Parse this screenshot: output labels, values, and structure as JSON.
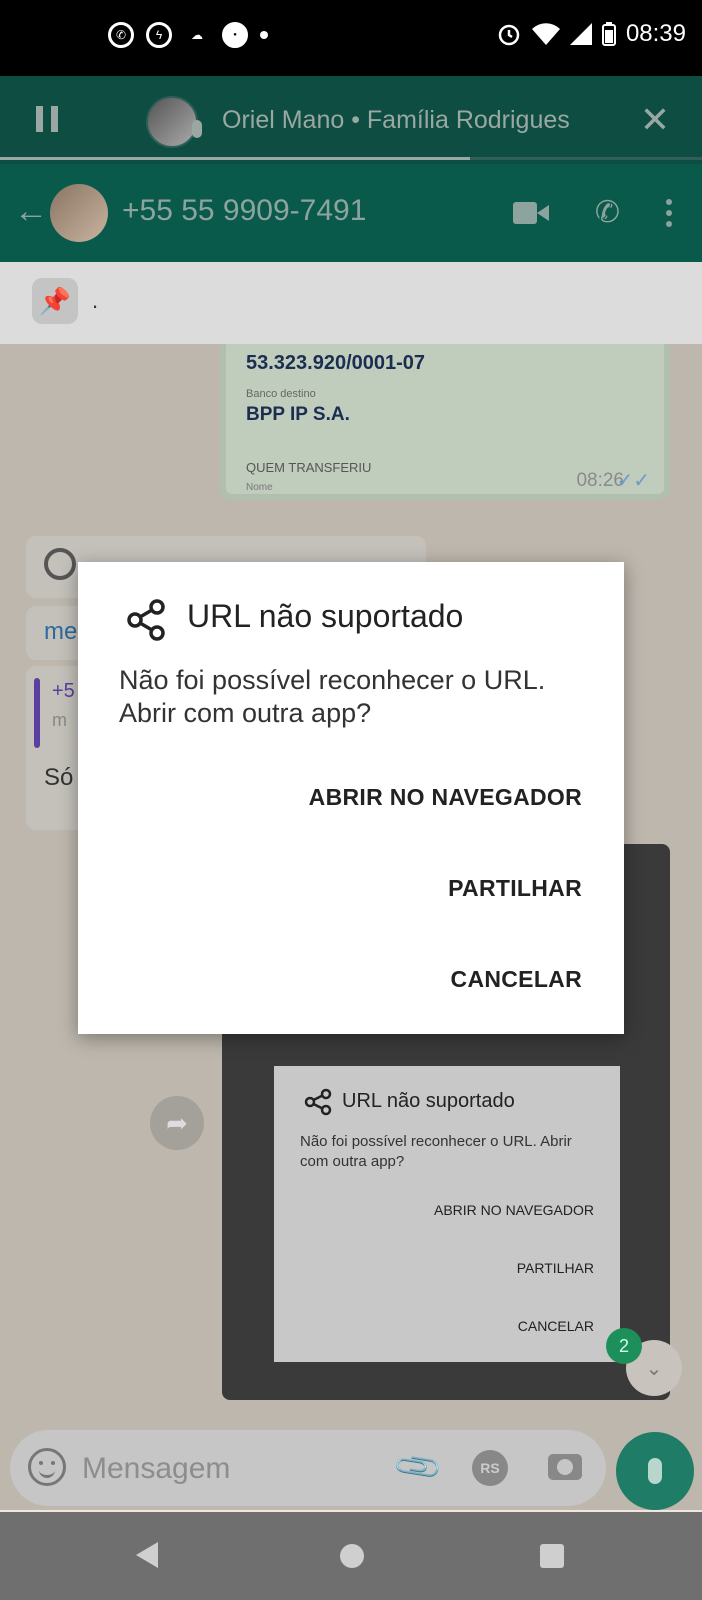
{
  "status_bar": {
    "time": "08:39"
  },
  "voice_bar": {
    "title": "Oriel Mano • Família Rodrigues",
    "progress": 0.67
  },
  "chat_header": {
    "title": "+55 55 9909-7491"
  },
  "pinned": {
    "text": "."
  },
  "receipt": {
    "cnpj": "53.323.920/0001-07",
    "bank_label": "Banco destino",
    "bank": "BPP IP S.A.",
    "section": "QUEM TRANSFERIU",
    "name_label": "Nome",
    "time": "08:26"
  },
  "bubbles": {
    "link_fragment": "me",
    "quote_title": "+5",
    "quote_preview": "m",
    "message": "Só"
  },
  "mini_dialog": {
    "title": "URL não suportado",
    "message": "Não foi possível reconhecer o URL. Abrir com outra app?",
    "open_browser": "ABRIR NO NAVEGADOR",
    "share": "PARTILHAR",
    "cancel": "CANCELAR",
    "badge": "2"
  },
  "input": {
    "placeholder": "Mensagem",
    "rs_label": "RS"
  },
  "dialog": {
    "title": "URL não suportado",
    "message": "Não foi possível reconhecer o URL. Abrir com outra app?",
    "open_browser": "ABRIR NO NAVEGADOR",
    "share": "PARTILHAR",
    "cancel": "CANCELAR"
  }
}
